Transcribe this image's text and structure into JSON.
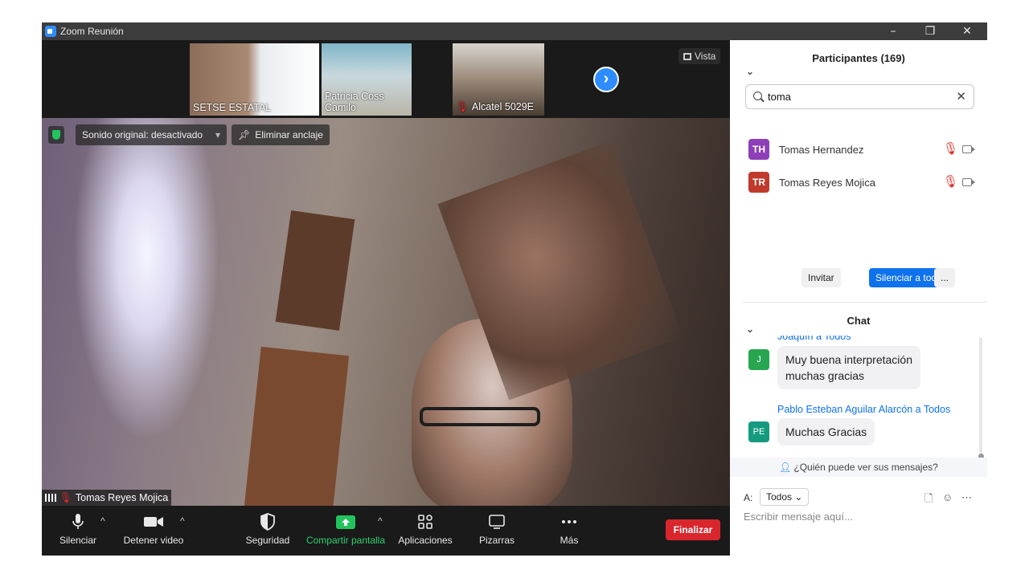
{
  "window": {
    "title": "Zoom Reunión",
    "minimize": "–",
    "restore": "❐",
    "close": "✕"
  },
  "stage": {
    "thumbnails": [
      {
        "name": "SETSE ESTATAL",
        "muted": false
      },
      {
        "name": "Patricia Coss Camilo",
        "muted": false
      },
      {
        "name": "Alcatel 5029E",
        "muted": true
      }
    ],
    "next_arrow": "›",
    "view_label": "Vista",
    "audio_label": "Sonido original: desactivado",
    "unpin_label": "Eliminar anclaje",
    "speaker_name": "Tomas Reyes Mojica"
  },
  "toolbar": {
    "mute": "Silenciar",
    "stop_video": "Detener video",
    "security": "Seguridad",
    "share_screen": "Compartir pantalla",
    "apps": "Aplicaciones",
    "whiteboards": "Pizarras",
    "more": "Más",
    "end": "Finalizar"
  },
  "participants": {
    "title": "Participantes (169)",
    "search_value": "toma",
    "list": [
      {
        "initials": "TH",
        "name": "Tomas Hernandez",
        "color": "#8e3fb7"
      },
      {
        "initials": "TR",
        "name": "Tomas Reyes Mojica",
        "color": "#c0392b"
      }
    ],
    "invite": "Invitar",
    "mute_all": "Silenciar a todos",
    "more": "..."
  },
  "chat": {
    "title": "Chat",
    "cut_sender": "Joaquín a Todos",
    "messages": [
      {
        "initial": "J",
        "color": "#27a550",
        "sender": "",
        "text_line1": "Muy buena interpretación",
        "text_line2": "muchas gracias"
      },
      {
        "initial": "PE",
        "color": "#159a7f",
        "sender": "Pablo Esteban Aguilar Alarcón a Todos",
        "text_line1": "Muchas Gracias",
        "text_line2": ""
      }
    ],
    "who_can_see": "¿Quién puede ver sus mensajes?",
    "to_label": "A:",
    "to_value": "Todos",
    "placeholder": "Escribir mensaje aquí..."
  }
}
